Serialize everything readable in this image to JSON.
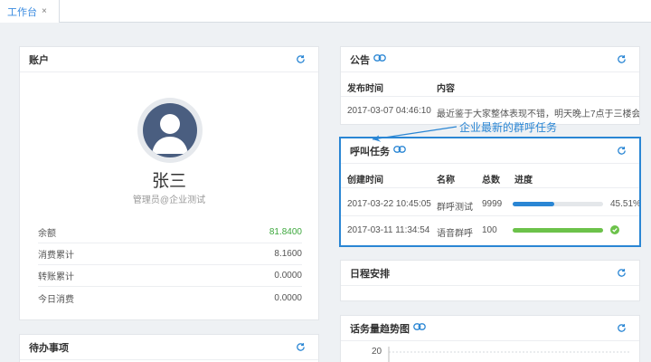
{
  "tab": {
    "label": "工作台",
    "close_glyph": "×"
  },
  "account": {
    "title": "账户",
    "name": "张三",
    "role": "管理员@企业测试",
    "rows": [
      {
        "label": "余额",
        "value": "81.8400",
        "color": "#3da83d"
      },
      {
        "label": "消费累计",
        "value": "8.1600"
      },
      {
        "label": "转账累计",
        "value": "0.0000"
      },
      {
        "label": "今日消费",
        "value": "0.0000"
      }
    ]
  },
  "todo": {
    "title": "待办事项"
  },
  "announcement": {
    "title": "公告",
    "columns": [
      "发布时间",
      "内容"
    ],
    "rows": [
      {
        "time": "2017-03-07 04:46:10",
        "content": "最近鉴于大家整体表现不错，明天晚上7点于三楼会议"
      }
    ]
  },
  "calls": {
    "title": "呼叫任务",
    "annotation": "企业最新的群呼任务",
    "columns": [
      "创建时间",
      "名称",
      "总数",
      "进度"
    ],
    "rows": [
      {
        "created": "2017-03-22 10:45:05",
        "name": "群呼测试",
        "total": "9999",
        "progress": 0.4551,
        "progress_label": "45.51%",
        "color": "#2a86d4"
      },
      {
        "created": "2017-03-11 11:34:54",
        "name": "语音群呼",
        "total": "100",
        "progress": 1.0,
        "progress_label": "",
        "color": "#6cc24a"
      }
    ]
  },
  "schedule": {
    "title": "日程安排"
  },
  "trend": {
    "title": "话务量趋势图",
    "y_tick": "20"
  },
  "icons": {
    "refresh": "refresh-icon",
    "link": "link-icon",
    "complete": "check-circle-icon"
  },
  "colors": {
    "accent": "#2a86d4",
    "success": "#6cc24a",
    "balance": "#3da83d"
  }
}
